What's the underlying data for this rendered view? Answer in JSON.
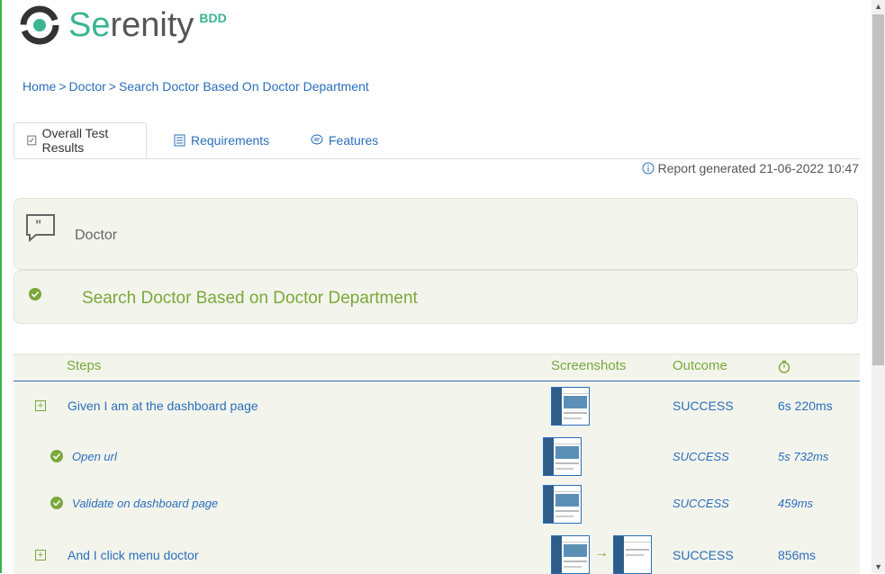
{
  "brand": {
    "prefix": "Se",
    "suffix": "renity",
    "sub": "BDD"
  },
  "breadcrumb": {
    "home": "Home",
    "sep": ">",
    "doctor": "Doctor",
    "current": "Search Doctor Based On Doctor Department"
  },
  "tabs": [
    {
      "label": "Overall Test Results",
      "icon": "checklist-icon"
    },
    {
      "label": "Requirements",
      "icon": "book-icon"
    },
    {
      "label": "Features",
      "icon": "comment-icon"
    }
  ],
  "report": {
    "text": "Report generated 21-06-2022 10:47"
  },
  "feature": {
    "title": "Doctor"
  },
  "scenario": {
    "title": "Search Doctor Based on Doctor Department",
    "status": "passed"
  },
  "table": {
    "headers": {
      "steps": "Steps",
      "screenshots": "Screenshots",
      "outcome": "Outcome",
      "duration_icon": "stopwatch-icon"
    },
    "rows": [
      {
        "desc": "Given I am at the dashboard page",
        "outcome": "SUCCESS",
        "time": "6s 220ms"
      },
      {
        "desc": "Open url",
        "outcome": "SUCCESS",
        "time": "5s 732ms"
      },
      {
        "desc": "Validate on dashboard page",
        "outcome": "SUCCESS",
        "time": "459ms"
      },
      {
        "desc": "And I click menu doctor",
        "outcome": "SUCCESS",
        "time": "856ms",
        "arrow": "→"
      }
    ]
  },
  "colors": {
    "accent_green": "#7aa83a",
    "link_blue": "#2a6ebb",
    "panel_bg": "#f3f4ec",
    "logo_green": "#3bb590"
  }
}
